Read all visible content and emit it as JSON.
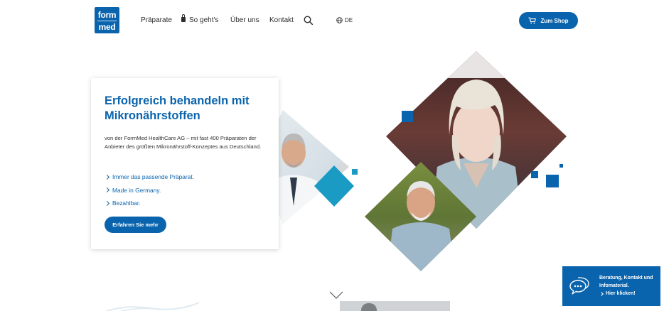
{
  "header": {
    "logo_line1": "form",
    "logo_line2": "med",
    "nav": {
      "praeparate": "Präparate",
      "so_gehts": "So geht's",
      "ueber_uns": "Über uns",
      "kontakt": "Kontakt"
    },
    "language": "DE",
    "shop_button": "Zum Shop"
  },
  "hero": {
    "title": "Erfolgreich behandeln mit Mikronährstoffen",
    "text": "von der FormMed HealthCare AG – mit fast 400 Präparaten der Anbieter des größten Mikronährstoff-Konzeptes aus Deutschland.",
    "bullets": [
      "Immer das passende Präparat.",
      "Made in Germany.",
      "Bezahlbar."
    ],
    "cta": "Erfahren Sie mehr"
  },
  "chat": {
    "line1": "Beratung, Kontakt und",
    "line2": "Infomaterial.",
    "link": "Hier klicken!"
  },
  "colors": {
    "brand_blue": "#0a64ad",
    "teal_accent": "#1a9bc4"
  }
}
